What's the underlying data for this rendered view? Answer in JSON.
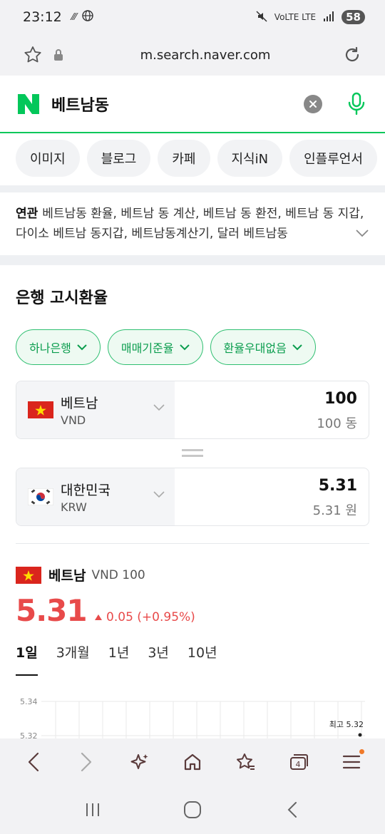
{
  "status_bar": {
    "time": "23:12",
    "signal_text": "VoLTE LTE",
    "battery": "58"
  },
  "browser": {
    "url": "m.search.naver.com"
  },
  "search": {
    "query": "베트남동"
  },
  "tabs": [
    "이미지",
    "블로그",
    "카페",
    "지식iN",
    "인플루언서"
  ],
  "related": {
    "label": "연관",
    "text": "베트남동 환율, 베트남 동 계산, 베트남 동 환전, 베트남 동 지갑, 다이소 베트남 동지갑, 베트남동계산기, 달러 베트남동"
  },
  "exchange": {
    "title": "은행 고시환율",
    "filters": [
      "하나은행",
      "매매기준율",
      "환율우대없음"
    ],
    "from": {
      "name": "베트남",
      "code": "VND",
      "amount": "100",
      "amount_text": "100 동"
    },
    "to": {
      "name": "대한민국",
      "code": "KRW",
      "amount": "5.31",
      "amount_text": "5.31 원"
    },
    "rate": {
      "country": "베트남",
      "unit": "VND 100",
      "value": "5.31",
      "change": "0.05 (+0.95%)"
    },
    "periods": [
      "1일",
      "3개월",
      "1년",
      "3년",
      "10년"
    ],
    "active_period": "1일"
  },
  "chart_data": {
    "type": "line",
    "y_ticks": [
      "5.34",
      "5.32"
    ],
    "annotation": "최고 5.32",
    "max_point": 5.32,
    "colors": {
      "up": "#e84a4a",
      "grid": "#e8e8e8"
    }
  },
  "colors": {
    "naver_green": "#03c75a",
    "rise_red": "#e84a4a",
    "filter_green": "#0b9d4e"
  }
}
